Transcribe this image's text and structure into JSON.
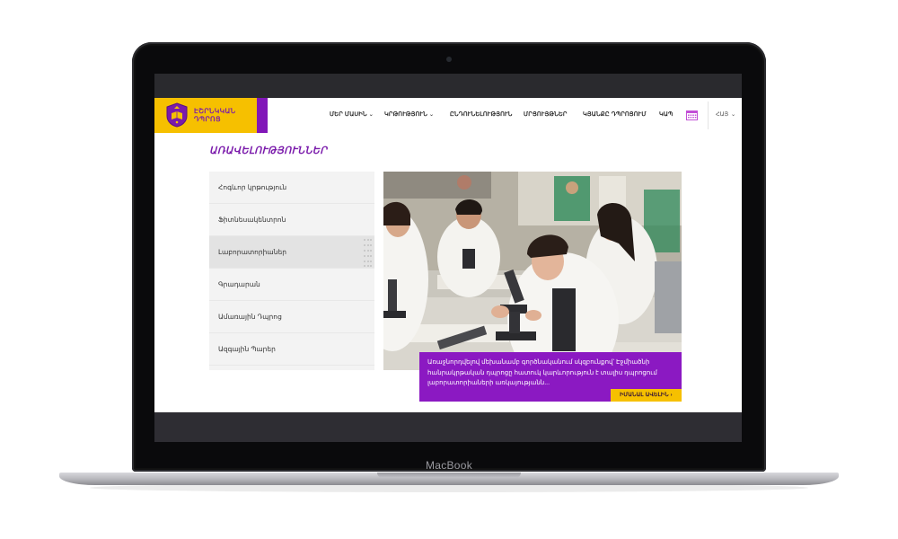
{
  "device": {
    "brand_label": "MacBook"
  },
  "site": {
    "logo_text_line1": "ԷՇՐՆԿԿԱՆ",
    "logo_text_line2": "ԴՊՐՈՑ",
    "nav": [
      {
        "label": "ՄԵՐ ՄԱՍԻՆ",
        "has_dropdown": true
      },
      {
        "label": "ԿՐԹՈՒԹՅՈՒՆ",
        "has_dropdown": true
      },
      {
        "label": "ԸՆԴՈՒՆԵԼՈՒԹՅՈՒՆ",
        "has_dropdown": false
      },
      {
        "label": "ՄՐՑՈՒՅԹՆԵՐ",
        "has_dropdown": false
      },
      {
        "label": "ԿՅԱՆՔԸ ԴՊՐՈՑՈՒՄ",
        "has_dropdown": false
      },
      {
        "label": "ԿԱՊ",
        "has_dropdown": false
      }
    ],
    "chevron": "⌄",
    "language": "ՀԱՅ",
    "calendar_icon": "calendar-icon",
    "section_title": "ԱՌԱՎԵԼՈՒԹՅՈՒՆՆԵՐ",
    "menu_items": [
      {
        "label": "Հոգևոր կրթություն",
        "active": false
      },
      {
        "label": "Ֆիտնեսակենտրոն",
        "active": false
      },
      {
        "label": "Լաբորատորիաներ",
        "active": true
      },
      {
        "label": "Գրադարան",
        "active": false
      },
      {
        "label": "Ամառային Դպրոց",
        "active": false
      },
      {
        "label": "Ազգային Պարեր",
        "active": false
      }
    ],
    "caption": "Առաջնորդվելով մեխանամբ գործնականում սկզբունքով՝ Էջմիածնի հանրակրթական դպրոցը հատուկ կարևորություն է տալիս դպրոցում լաբորատորիաների առկայությանն...",
    "read_more": "ԻՄԱՆԱԼ ԱՎԵԼԻՆ ›",
    "colors": {
      "purple": "#8b19c2",
      "yellow": "#f6c000"
    }
  }
}
